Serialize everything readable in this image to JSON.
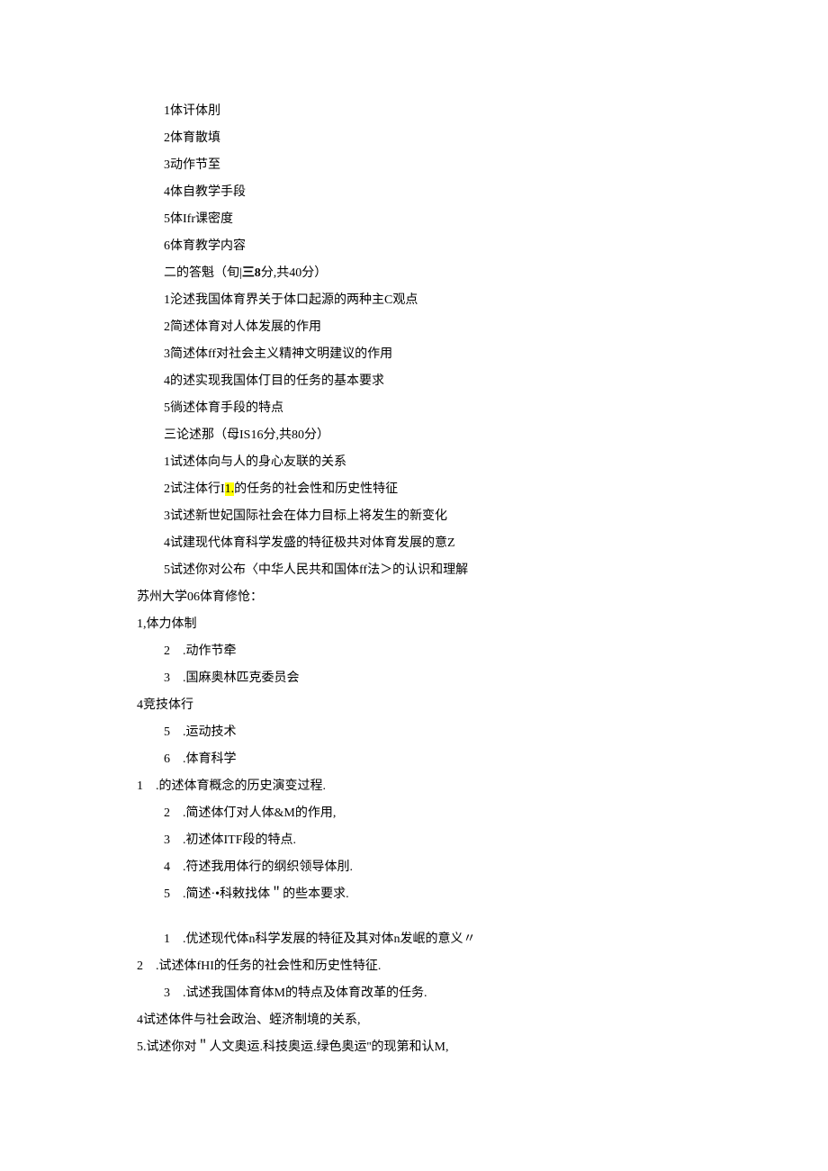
{
  "section1": {
    "items": [
      "1体讦体刖",
      "2体育散填",
      "3动作节至",
      "4体自教学手段",
      "5体Ifr课密度",
      "6体育教学内容"
    ]
  },
  "section2": {
    "header_pre": "二的答魁（旬|",
    "header_bold": "三8",
    "header_post": "分,共40分）",
    "items": [
      "1沦述我国体育界关于体口起源的两种主C观点",
      "2简述体育对人体发展的作用",
      "3简述体ff对社会主义精神文明建议的作用",
      "4的述实现我国体仃目的任务的基本要求",
      "5徜述体育手段的特点"
    ]
  },
  "section3": {
    "header": "三论述那（母IS16分,共80分）",
    "items_pre": "1试述体向与人的身心友联的关系",
    "item2_pre": "2试注体行I",
    "item2_highlight": "1.",
    "item2_post": "的任务的社会性和历史性特征",
    "items_post": [
      "3试述新世妃国际社会在体力目标上将发生的新变化",
      "4试建现代体育科学发盛的特征极共对体育发展的意Z",
      "5试述你对公布〈中华人民共和国体ff法＞的认识和理解"
    ]
  },
  "section4": {
    "header": "苏州大学06体育修怆：",
    "item1": "1,体力体制",
    "items_a": [
      "2　.动作节牵",
      "3　.国麻奥林匹克委员会"
    ],
    "item4": "4竞技体行",
    "items_b": [
      "5　.运动技术",
      "6　.体育科学"
    ]
  },
  "section5": {
    "items": [
      "1　.的述体育概念的历史演变过程.",
      "2　.简述体仃对人体&M的作用,",
      "3　.初述体ITF段的特点.",
      "4　.符述我用体行的纲织领导体刖.",
      "5　.简述·•科敕找体＂的些本要求."
    ]
  },
  "section6": {
    "item1": "1　.优述现代体n科学发展的特征及其对体n发岷的意义〃",
    "item2": "2　.试述体fHI的任务的社会性和历史性特征.",
    "item3": "3　.试述我国体育体M的特点及体育改革的任务.",
    "item4": "4试述体件与社会政治、蛭济制境的关系,",
    "item5": "5.试述你对＂人文奥运.科技奥运.绿色奥运''的现第和认M,"
  }
}
